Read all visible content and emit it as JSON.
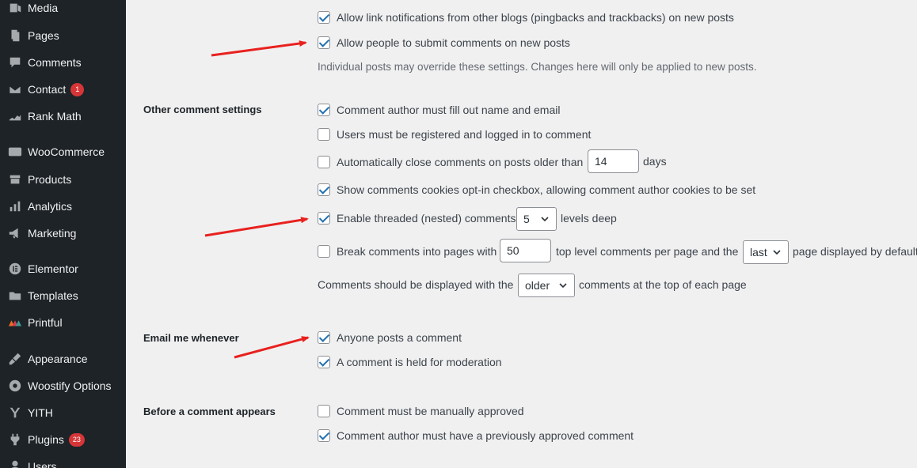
{
  "sidebar": {
    "items": [
      {
        "label": "Media",
        "icon": "media-icon"
      },
      {
        "label": "Pages",
        "icon": "pages-icon"
      },
      {
        "label": "Comments",
        "icon": "comments-icon"
      },
      {
        "label": "Contact",
        "icon": "contact-icon",
        "badge": "1"
      },
      {
        "label": "Rank Math",
        "icon": "rank-math-icon"
      },
      {
        "label": "WooCommerce",
        "icon": "woocommerce-icon"
      },
      {
        "label": "Products",
        "icon": "products-icon"
      },
      {
        "label": "Analytics",
        "icon": "analytics-icon"
      },
      {
        "label": "Marketing",
        "icon": "marketing-icon"
      },
      {
        "label": "Elementor",
        "icon": "elementor-icon"
      },
      {
        "label": "Templates",
        "icon": "templates-icon"
      },
      {
        "label": "Printful",
        "icon": "printful-icon"
      },
      {
        "label": "Appearance",
        "icon": "appearance-icon"
      },
      {
        "label": "Woostify Options",
        "icon": "woostify-icon"
      },
      {
        "label": "YITH",
        "icon": "yith-icon"
      },
      {
        "label": "Plugins",
        "icon": "plugins-icon",
        "badge": "23"
      },
      {
        "label": "Users",
        "icon": "users-icon"
      }
    ]
  },
  "settings": {
    "top": {
      "pingbacks": {
        "label": "Allow link notifications from other blogs (pingbacks and trackbacks) on new posts",
        "checked": true
      },
      "allow_comments": {
        "label": "Allow people to submit comments on new posts",
        "checked": true
      },
      "description": "Individual posts may override these settings. Changes here will only be applied to new posts."
    },
    "other": {
      "heading": "Other comment settings",
      "require_name_email": {
        "label": "Comment author must fill out name and email",
        "checked": true
      },
      "registered_only": {
        "label": "Users must be registered and logged in to comment",
        "checked": false
      },
      "auto_close": {
        "label": "Automatically close comments on posts older than",
        "checked": false,
        "value": "14",
        "suffix": "days"
      },
      "cookies_optin": {
        "label": "Show comments cookies opt-in checkbox, allowing comment author cookies to be set",
        "checked": true
      },
      "threaded": {
        "label": "Enable threaded (nested) comments",
        "checked": true,
        "value": "5",
        "suffix": "levels deep"
      },
      "paged": {
        "label": "Break comments into pages with",
        "checked": false,
        "value": "50",
        "middle": "top level comments per page and the",
        "select": "last",
        "suffix": "page displayed by default"
      },
      "order": {
        "prefix": "Comments should be displayed with the",
        "select": "older",
        "suffix": "comments at the top of each page"
      }
    },
    "email": {
      "heading": "Email me whenever",
      "anyone_posts": {
        "label": "Anyone posts a comment",
        "checked": true
      },
      "held_moderation": {
        "label": "A comment is held for moderation",
        "checked": true
      }
    },
    "before": {
      "heading": "Before a comment appears",
      "manual_approve": {
        "label": "Comment must be manually approved",
        "checked": false
      },
      "prev_approved": {
        "label": "Comment author must have a previously approved comment",
        "checked": true
      }
    }
  },
  "colors": {
    "sidebar_bg": "#1d2327",
    "content_bg": "#f0f0f1",
    "checkbox_accent": "#2271b1",
    "badge": "#d63638",
    "arrow": "#e8211e"
  }
}
